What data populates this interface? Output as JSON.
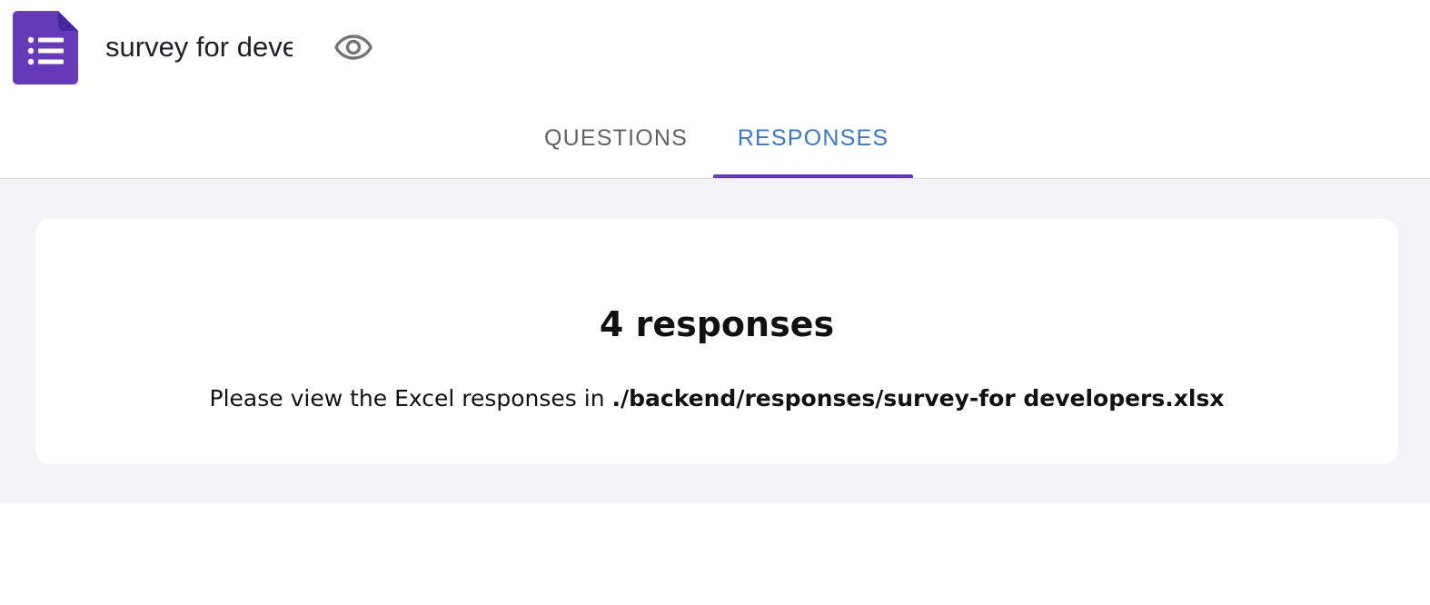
{
  "header": {
    "form_title": "survey for deve",
    "icons": {
      "logo": "google-forms-list-icon",
      "preview": "eye-icon"
    },
    "colors": {
      "logo": "#673ab7",
      "preview_icon": "#757575"
    }
  },
  "tabs": {
    "items": [
      {
        "label": "QUESTIONS",
        "active": false
      },
      {
        "label": "RESPONSES",
        "active": true
      }
    ],
    "colors": {
      "active_text": "#3d76c6",
      "inactive_text": "#5f6368",
      "underline": "#673ab7"
    }
  },
  "responses": {
    "count_label": "4 responses",
    "hint_prefix": "Please view the Excel responses in ",
    "file_path": "./backend/responses/survey-for developers.xlsx"
  },
  "colors": {
    "page_background": "#f4f4f8",
    "card_background": "#ffffff"
  }
}
